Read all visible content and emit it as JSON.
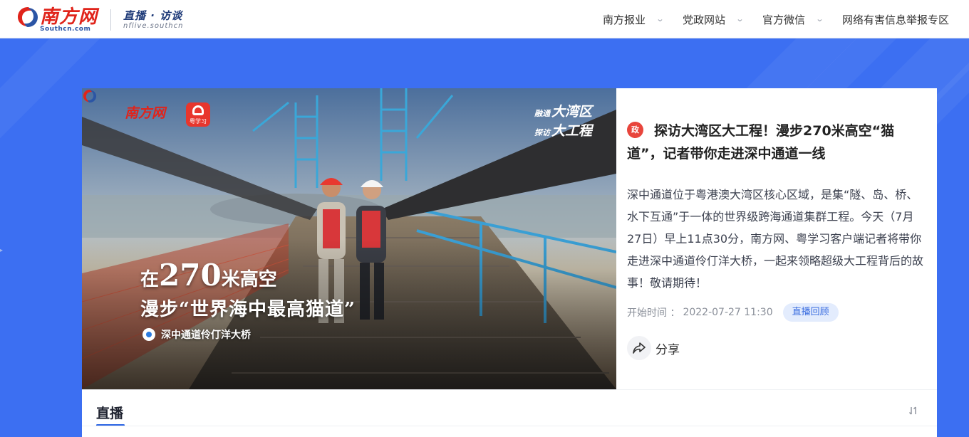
{
  "header": {
    "logo_cn": "南方网",
    "logo_en": "Southcn.com",
    "sub_brand_cn": "直播 · 访谈",
    "sub_brand_en": "nflive.southcn",
    "nav": [
      {
        "label": "南方报业",
        "has_dropdown": true
      },
      {
        "label": "党政网站",
        "has_dropdown": true
      },
      {
        "label": "官方微信",
        "has_dropdown": true
      },
      {
        "label": "网络有害信息举报专区",
        "has_dropdown": false
      }
    ]
  },
  "cover": {
    "logo_cn": "南方网",
    "app_label": "粤学习",
    "brand_top_small": "融通",
    "brand_top_big": "大湾区",
    "brand_bottom_small": "探访",
    "brand_bottom_big": "大工程",
    "headline_1_prefix": "在",
    "headline_1_number": "270",
    "headline_1_suffix": "米高空",
    "headline_2": "漫步“世界海中最高猫道”",
    "location": "深中通道伶仃洋大桥"
  },
  "article": {
    "tag": "政",
    "title_line1": "探访大湾区大工程！漫步270米高空“猫",
    "title_line2": "道”，记者带你走进深中通道一线",
    "description": "深中通道位于粤港澳大湾区核心区域，是集“隧、岛、桥、水下互通”于一体的世界级跨海通道集群工程。今天（7月27日）早上11点30分，南方网、粤学习客户端记者将带你走进深中通道伶仃洋大桥，一起来领略超级大工程背后的故事！敬请期待！",
    "start_label": "开始时间 ：",
    "start_time": "2022-07-27 11:30",
    "status_badge": "直播回顾",
    "share_label": "分享"
  },
  "panel": {
    "tab_label": "直播"
  },
  "colors": {
    "page_bg": "#3c6ff2",
    "accent": "#2b64e3",
    "logo_red": "#e0241b",
    "badge_bg": "#e3ecfd",
    "badge_text": "#3a6de0"
  }
}
